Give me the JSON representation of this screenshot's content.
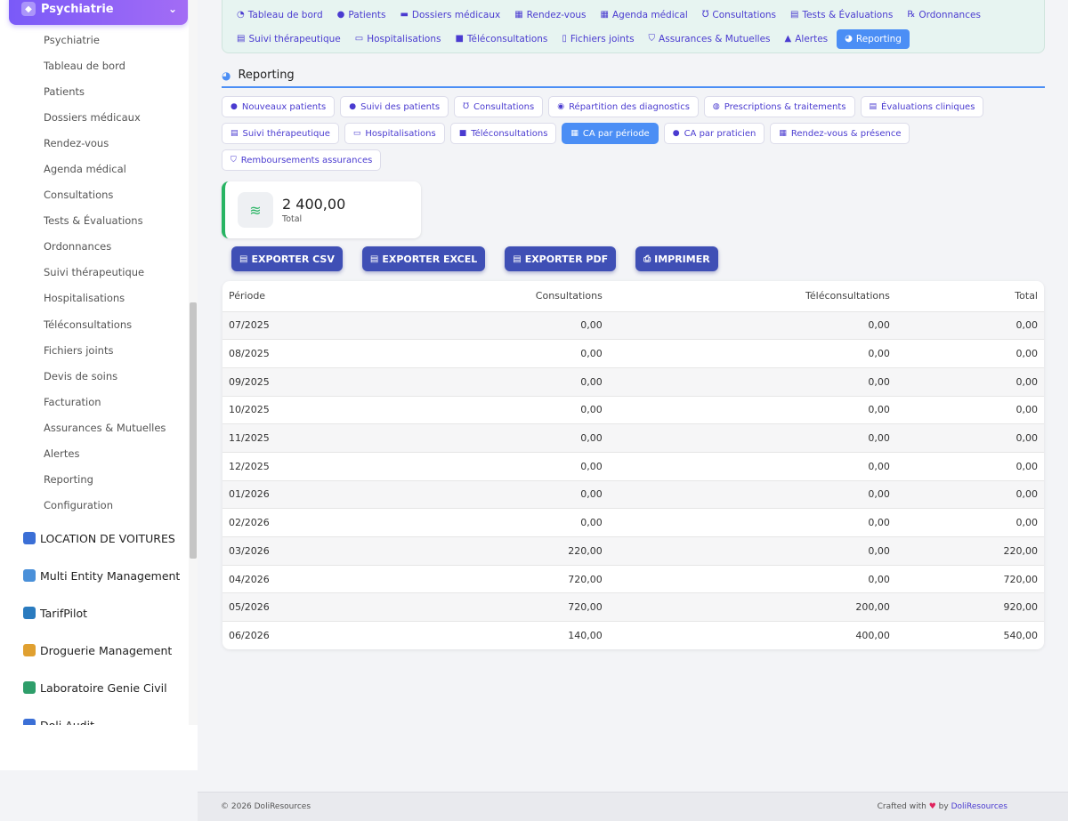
{
  "sidebar": {
    "active_module": "Psychiatrie",
    "sub_items": [
      "Psychiatrie",
      "Tableau de bord",
      "Patients",
      "Dossiers médicaux",
      "Rendez-vous",
      "Agenda médical",
      "Consultations",
      "Tests & Évaluations",
      "Ordonnances",
      "Suivi thérapeutique",
      "Hospitalisations",
      "Téléconsultations",
      "Fichiers joints",
      "Devis de soins",
      "Facturation",
      "Assurances & Mutuelles",
      "Alertes",
      "Reporting",
      "Configuration"
    ],
    "modules": [
      {
        "label": "LOCATION DE VOITURES",
        "color": "#3b6fd6"
      },
      {
        "label": "Multi Entity Management",
        "color": "#4a90d9"
      },
      {
        "label": "TarifPilot",
        "color": "#2a7bbf"
      },
      {
        "label": "Droguerie Management",
        "color": "#e0a030"
      },
      {
        "label": "Laboratoire Genie Civil",
        "color": "#2e9e6a"
      },
      {
        "label": "Doli Audit",
        "color": "#3b6fd6"
      }
    ]
  },
  "topnav": {
    "row1": [
      {
        "label": "Tableau de bord",
        "icon": "dashboard-icon"
      },
      {
        "label": "Patients",
        "icon": "user-icon"
      },
      {
        "label": "Dossiers médicaux",
        "icon": "folder-icon"
      },
      {
        "label": "Rendez-vous",
        "icon": "calendar-check-icon"
      },
      {
        "label": "Agenda médical",
        "icon": "calendar-icon"
      },
      {
        "label": "Consultations",
        "icon": "stethoscope-icon"
      },
      {
        "label": "Tests & Évaluations",
        "icon": "clipboard-icon"
      },
      {
        "label": "Ordonnances",
        "icon": "prescription-icon"
      }
    ],
    "row2": [
      {
        "label": "Suivi thérapeutique",
        "icon": "clipboard-check-icon"
      },
      {
        "label": "Hospitalisations",
        "icon": "bed-icon"
      },
      {
        "label": "Téléconsultations",
        "icon": "video-icon"
      },
      {
        "label": "Fichiers joints",
        "icon": "file-icon"
      },
      {
        "label": "Assurances & Mutuelles",
        "icon": "shield-icon"
      },
      {
        "label": "Alertes",
        "icon": "warning-icon"
      },
      {
        "label": "Reporting",
        "icon": "pie-chart-icon",
        "active": true
      }
    ]
  },
  "section": {
    "title": "Reporting"
  },
  "subtabs": {
    "row1": [
      {
        "label": "Nouveaux patients",
        "icon": "user-plus-icon"
      },
      {
        "label": "Suivi des patients",
        "icon": "user-check-icon"
      },
      {
        "label": "Consultations",
        "icon": "stethoscope-icon"
      },
      {
        "label": "Répartition des diagnostics",
        "icon": "brain-icon"
      },
      {
        "label": "Prescriptions & traitements",
        "icon": "pills-icon"
      },
      {
        "label": "Évaluations cliniques",
        "icon": "clipboard-icon"
      }
    ],
    "row2": [
      {
        "label": "Suivi thérapeutique",
        "icon": "clipboard-check-icon"
      },
      {
        "label": "Hospitalisations",
        "icon": "bed-icon"
      },
      {
        "label": "Téléconsultations",
        "icon": "video-icon"
      },
      {
        "label": "CA par période",
        "icon": "calendar-icon",
        "active": true
      },
      {
        "label": "CA par praticien",
        "icon": "user-doctor-icon"
      },
      {
        "label": "Rendez-vous & présence",
        "icon": "calendar-check-icon"
      }
    ],
    "row3": [
      {
        "label": "Remboursements assurances",
        "icon": "shield-icon"
      }
    ]
  },
  "stat": {
    "value": "2 400,00",
    "label": "Total",
    "accent": "#28b463"
  },
  "exports": {
    "csv": "EXPORTER CSV",
    "excel": "EXPORTER EXCEL",
    "pdf": "EXPORTER PDF",
    "print": "IMPRIMER"
  },
  "table": {
    "headers": [
      "Période",
      "Consultations",
      "Téléconsultations",
      "Total"
    ],
    "rows": [
      [
        "07/2025",
        "0,00",
        "0,00",
        "0,00"
      ],
      [
        "08/2025",
        "0,00",
        "0,00",
        "0,00"
      ],
      [
        "09/2025",
        "0,00",
        "0,00",
        "0,00"
      ],
      [
        "10/2025",
        "0,00",
        "0,00",
        "0,00"
      ],
      [
        "11/2025",
        "0,00",
        "0,00",
        "0,00"
      ],
      [
        "12/2025",
        "0,00",
        "0,00",
        "0,00"
      ],
      [
        "01/2026",
        "0,00",
        "0,00",
        "0,00"
      ],
      [
        "02/2026",
        "0,00",
        "0,00",
        "0,00"
      ],
      [
        "03/2026",
        "220,00",
        "0,00",
        "220,00"
      ],
      [
        "04/2026",
        "720,00",
        "0,00",
        "720,00"
      ],
      [
        "05/2026",
        "720,00",
        "200,00",
        "920,00"
      ],
      [
        "06/2026",
        "140,00",
        "400,00",
        "540,00"
      ]
    ]
  },
  "footer": {
    "copyright": "© 2026 DoliResources",
    "crafted": "Crafted with",
    "by": "by",
    "brand": "DoliResources"
  }
}
